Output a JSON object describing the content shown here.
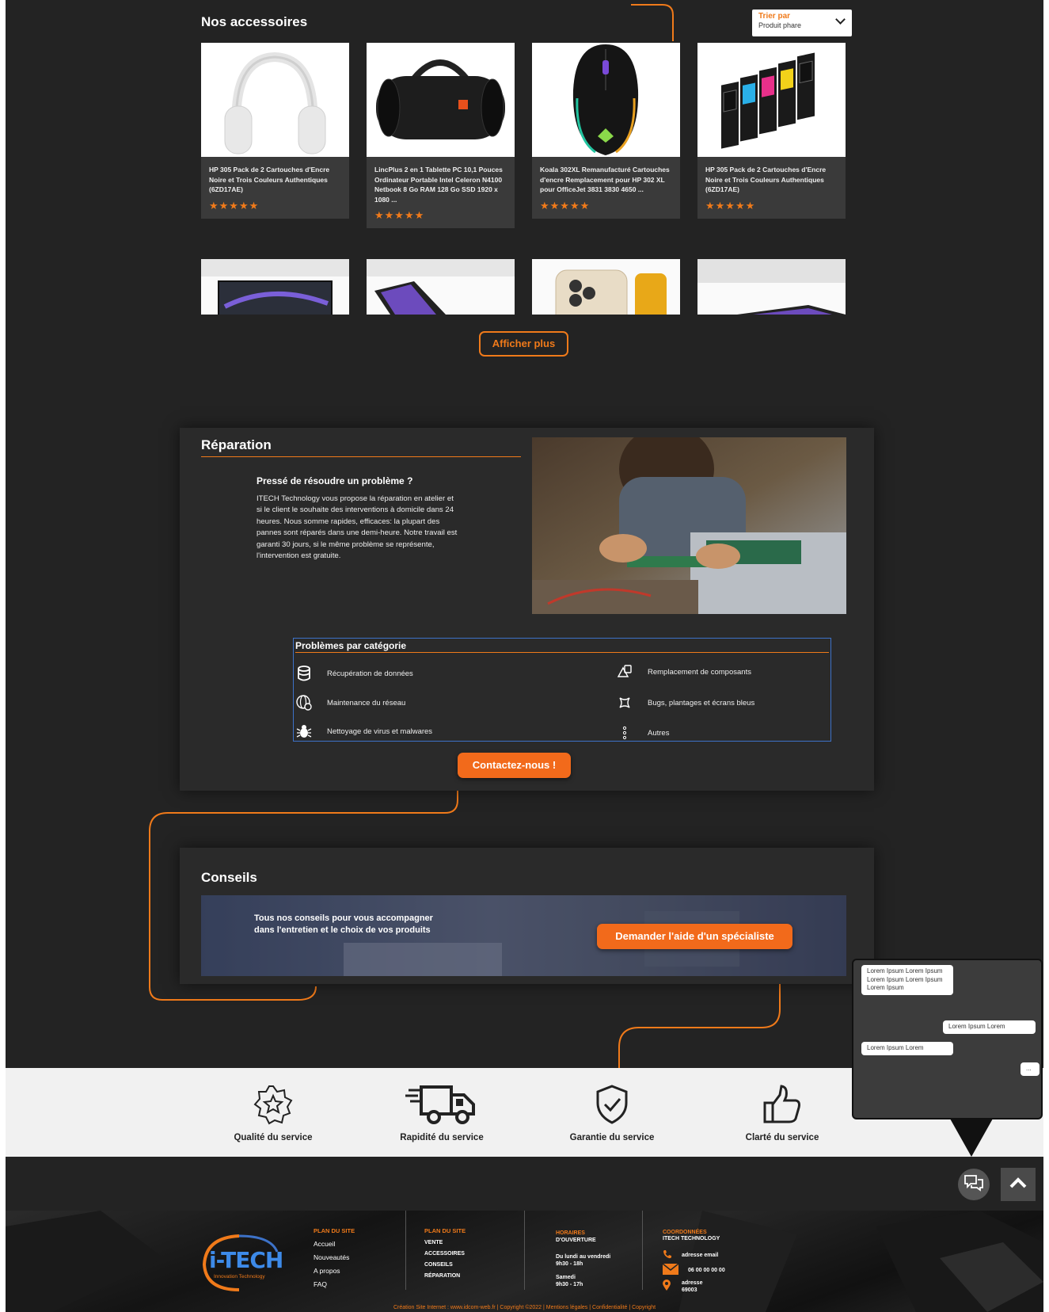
{
  "accessories": {
    "title": "Nos accessoires",
    "sort": {
      "label": "Trier par",
      "value": "Produit phare"
    },
    "products": [
      {
        "name": "HP 305 Pack de 2 Cartouches d'Encre Noire et Trois Couleurs Authentiques (6ZD17AE)",
        "rating": 5,
        "image": "headphones"
      },
      {
        "name": "LincPlus 2 en 1 Tablette PC 10,1 Pouces Ordinateur Portable Intel Celeron N4100 Netbook 8 Go RAM 128 Go SSD 1920 x 1080 ...",
        "rating": 5,
        "image": "jbl-speaker"
      },
      {
        "name": "Koala 302XL Remanufacturé Cartouches d'encre Remplacement pour HP 302 XL pour OfficeJet 3831 3830 4650 ...",
        "rating": 5,
        "image": "gaming-mouse"
      },
      {
        "name": "HP 305 Pack de 2 Cartouches d'Encre Noire et Trois Couleurs Authentiques (6ZD17AE)",
        "rating": 5,
        "image": "ink-cartridges"
      }
    ],
    "more_button": "Afficher plus"
  },
  "repair": {
    "title": "Réparation",
    "subtitle": "Pressé de résoudre un problème ?",
    "text": "ITECH Technology vous propose la réparation en atelier et si le client le souhaite des interventions à domicile dans 24 heures. Nous somme rapides, efficaces: la plupart des pannes sont réparés dans une demi-heure. Notre travail est  garanti 30 jours, si le même problème se représente, l'intervention est gratuite.",
    "categories_title": "Problèmes par catégorie",
    "categories": [
      {
        "label": "Récupération de données",
        "icon": "database-icon"
      },
      {
        "label": "Remplacement de composants",
        "icon": "shapes-icon"
      },
      {
        "label": "Maintenance du réseau",
        "icon": "network-gear-icon"
      },
      {
        "label": "Bugs, plantages et écrans bleus",
        "icon": "crash-icon"
      },
      {
        "label": "Nettoyage de virus et malwares",
        "icon": "bug-icon"
      },
      {
        "label": "Autres",
        "icon": "more-vertical-icon"
      }
    ],
    "contact_button": "Contactez-nous !"
  },
  "advice": {
    "title": "Conseils",
    "text": "Tous nos conseils pour vous accompagner dans l'entretien et le choix de vos produits",
    "button": "Demander l'aide d'un spécialiste"
  },
  "services": [
    {
      "label": "Qualité du service",
      "icon": "quality-star-icon"
    },
    {
      "label": "Rapidité du service",
      "icon": "delivery-truck-icon"
    },
    {
      "label": "Garantie du service",
      "icon": "shield-check-icon"
    },
    {
      "label": "Clarté du service",
      "icon": "thumbs-up-icon"
    }
  ],
  "chat": {
    "messages": [
      {
        "side": "left",
        "text": "Lorem Ipsum Lorem Ipsum Lorem Ipsum Lorem Ipsum Lorem Ipsum"
      },
      {
        "side": "right",
        "text": "Lorem Ipsum Lorem"
      },
      {
        "side": "left",
        "text": "Lorem Ipsum Lorem"
      },
      {
        "side": "right",
        "text": "..."
      }
    ]
  },
  "footer": {
    "logo_text": "i-TECH",
    "logo_tagline": "Innovation Technology",
    "col1": {
      "heading": "PLAN DU SITE",
      "links": [
        "Accueil",
        "Nouveautés",
        "A propos",
        "FAQ"
      ]
    },
    "col2": {
      "heading": "PLAN DU SITE",
      "links": [
        "VENTE",
        "ACCESSOIRES",
        "CONSEILS",
        "RÉPARATION"
      ]
    },
    "col3": {
      "heading": "HORAIRES",
      "subheading": "D'OUVERTURE",
      "weekdays": "Du lundi au vendredi",
      "weekdays_hours": "9h30 - 18h",
      "saturday": "Samedi",
      "saturday_hours": "9h30 - 17h"
    },
    "col4": {
      "heading": "COORDONNÉES",
      "company": "ITECH TECHNOLOGY",
      "email": "adresse email",
      "phone": "06 00 00 00 00",
      "address": "adresse",
      "postcode": "69003"
    },
    "copyright": "Création Site Internet : www.idcom-web.fr | Copyright ©2022 | Mentions légales | Confidentialité | Copyright"
  },
  "colors": {
    "accent": "#f07a1a",
    "background": "#232323",
    "panel": "#2a2a2a",
    "outline_blue": "#3d72c8"
  }
}
